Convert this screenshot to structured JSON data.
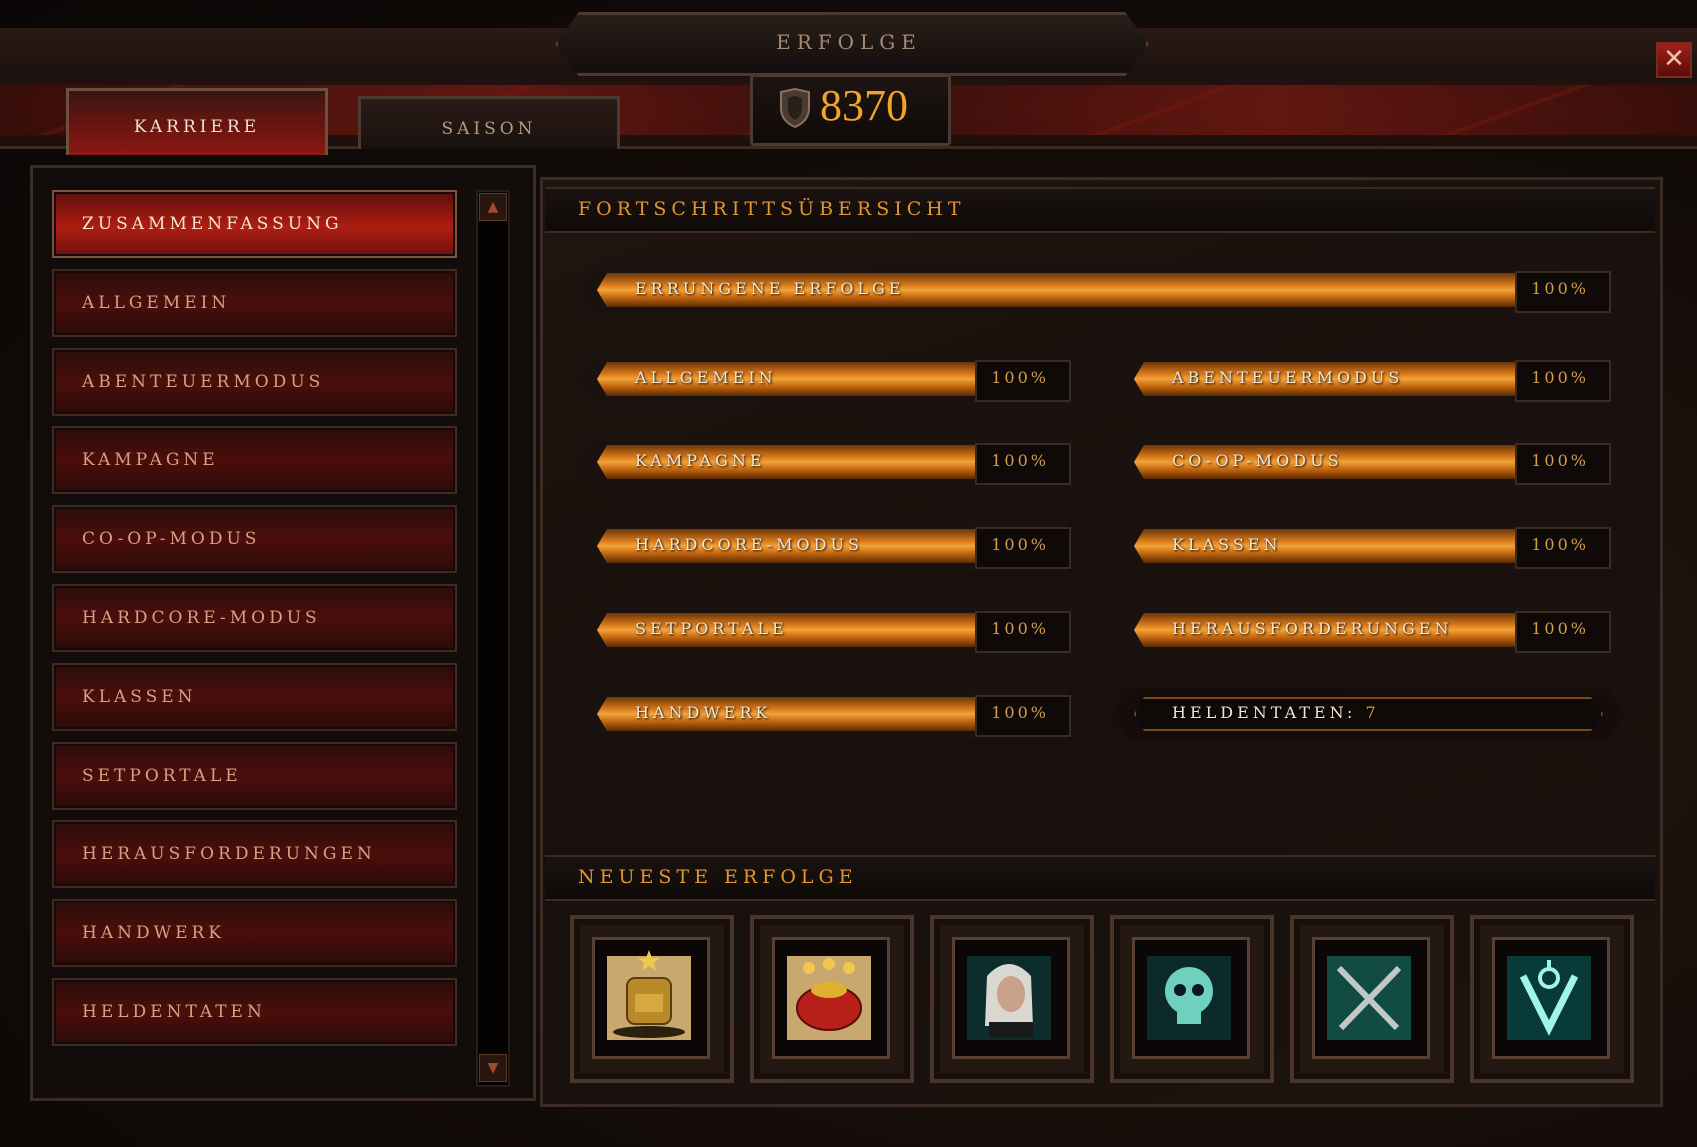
{
  "window": {
    "title": "ERFOLGE",
    "score": "8370",
    "close_label": "✕"
  },
  "tabs": [
    {
      "label": "KARRIERE",
      "active": true
    },
    {
      "label": "SAISON",
      "active": false
    }
  ],
  "sidebar": {
    "items": [
      {
        "label": "ZUSAMMENFASSUNG",
        "active": true
      },
      {
        "label": "ALLGEMEIN"
      },
      {
        "label": "ABENTEUERMODUS"
      },
      {
        "label": "KAMPAGNE"
      },
      {
        "label": "CO-OP-MODUS"
      },
      {
        "label": "HARDCORE-MODUS"
      },
      {
        "label": "KLASSEN"
      },
      {
        "label": "SETPORTALE"
      },
      {
        "label": "HERAUSFORDERUNGEN"
      },
      {
        "label": "HANDWERK"
      },
      {
        "label": "HELDENTATEN"
      }
    ],
    "scroll_up": "▲",
    "scroll_down": "▼"
  },
  "progress": {
    "heading": "FORTSCHRITTSÜBERSICHT",
    "overall": {
      "label": "ERRUNGENE ERFOLGE",
      "value": "100%",
      "fraction": 1.0
    },
    "categories": [
      {
        "label": "ALLGEMEIN",
        "value": "100%",
        "fraction": 1.0
      },
      {
        "label": "ABENTEUERMODUS",
        "value": "100%",
        "fraction": 1.0
      },
      {
        "label": "KAMPAGNE",
        "value": "100%",
        "fraction": 1.0
      },
      {
        "label": "CO-OP-MODUS",
        "value": "100%",
        "fraction": 1.0
      },
      {
        "label": "HARDCORE-MODUS",
        "value": "100%",
        "fraction": 1.0
      },
      {
        "label": "KLASSEN",
        "value": "100%",
        "fraction": 1.0
      },
      {
        "label": "SETPORTALE",
        "value": "100%",
        "fraction": 1.0
      },
      {
        "label": "HERAUSFORDERUNGEN",
        "value": "100%",
        "fraction": 1.0
      },
      {
        "label": "HANDWERK",
        "value": "100%",
        "fraction": 1.0
      }
    ],
    "feats": {
      "label": "HELDENTATEN:",
      "value": "7"
    }
  },
  "recent": {
    "heading": "NEUESTE ERFOLGE",
    "icons": [
      "backpack-stars-icon",
      "gold-bag-stars-icon",
      "white-haired-hero-portrait-icon",
      "glowing-skull-icon",
      "crossed-daggers-icon",
      "rune-v-icon"
    ]
  },
  "colors": {
    "accent": "#e1962f",
    "score": "#f2a32a",
    "bar_fill": "#d8791a",
    "active_red": "#b01d12"
  }
}
